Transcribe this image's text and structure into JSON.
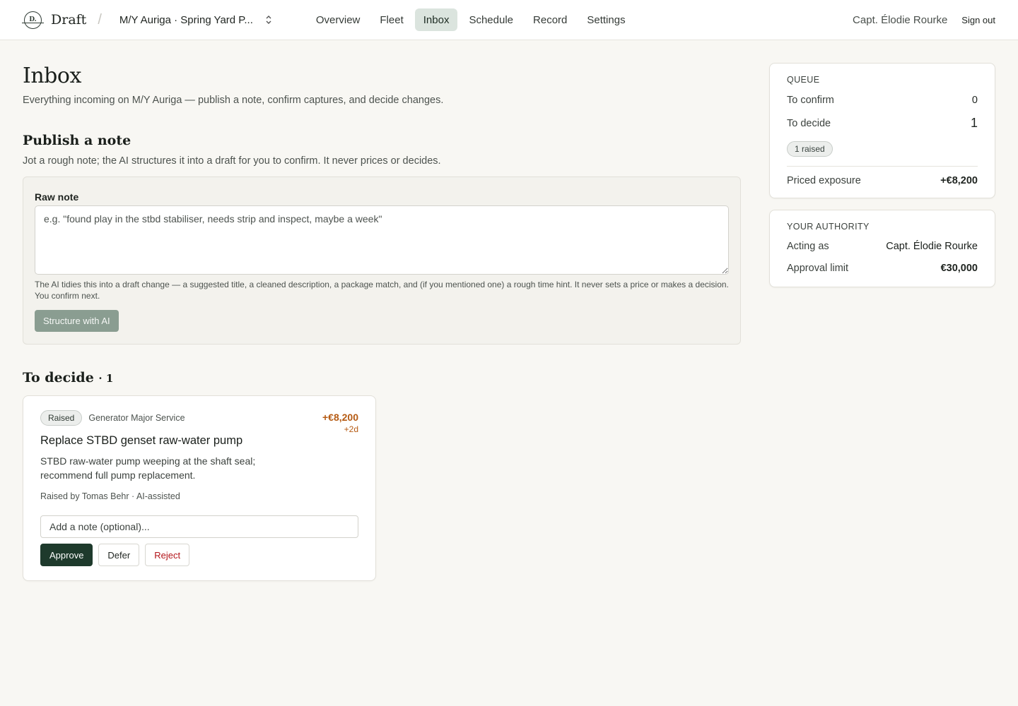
{
  "brand": {
    "logo_text": "D.",
    "name": "Draft"
  },
  "project": {
    "name": "M/Y Auriga · Spring Yard P..."
  },
  "nav": {
    "items": [
      {
        "label": "Overview",
        "active": false
      },
      {
        "label": "Fleet",
        "active": false
      },
      {
        "label": "Inbox",
        "active": true
      },
      {
        "label": "Schedule",
        "active": false
      },
      {
        "label": "Record",
        "active": false
      },
      {
        "label": "Settings",
        "active": false
      }
    ]
  },
  "user": {
    "name": "Capt. Élodie Rourke",
    "signout_label": "Sign out"
  },
  "page": {
    "title": "Inbox",
    "subtitle": "Everything incoming on M/Y Auriga — publish a note, confirm captures, and decide changes."
  },
  "publish": {
    "title": "Publish a note",
    "subtitle": "Jot a rough note; the AI structures it into a draft for you to confirm. It never prices or decides.",
    "field_label": "Raw note",
    "placeholder": "e.g. \"found play in the stbd stabiliser, needs strip and inspect, maybe a week\"",
    "helper": "The AI tidies this into a draft change — a suggested title, a cleaned description, a package match, and (if you mentioned one) a rough time hint. It never sets a price or makes a decision. You confirm next.",
    "button_label": "Structure with AI"
  },
  "decide": {
    "title": "To decide",
    "count": "· 1",
    "cards": [
      {
        "badge": "Raised",
        "package": "Generator Major Service",
        "price": "+€8,200",
        "days": "+2d",
        "title": "Replace STBD genset raw-water pump",
        "description": "STBD raw-water pump weeping at the shaft seal; recommend full pump replacement.",
        "meta": "Raised by Tomas Behr · AI-assisted",
        "note_placeholder": "Add a note (optional)...",
        "approve_label": "Approve",
        "defer_label": "Defer",
        "reject_label": "Reject"
      }
    ]
  },
  "queue": {
    "heading": "QUEUE",
    "to_confirm_label": "To confirm",
    "to_confirm_value": "0",
    "to_decide_label": "To decide",
    "to_decide_value": "1",
    "pill": "1 raised",
    "exposure_label": "Priced exposure",
    "exposure_value": "+€8,200"
  },
  "authority": {
    "heading": "YOUR AUTHORITY",
    "acting_label": "Acting as",
    "acting_value": "Capt. Élodie Rourke",
    "limit_label": "Approval limit",
    "limit_value": "€30,000"
  },
  "colors": {
    "background": "#f8f7f3",
    "nav_active": "#dbe4de",
    "primary_button": "#1e3a2c",
    "price_accent": "#b55a12",
    "reject_text": "#b3141a",
    "ai_button": "#8a9d91"
  }
}
